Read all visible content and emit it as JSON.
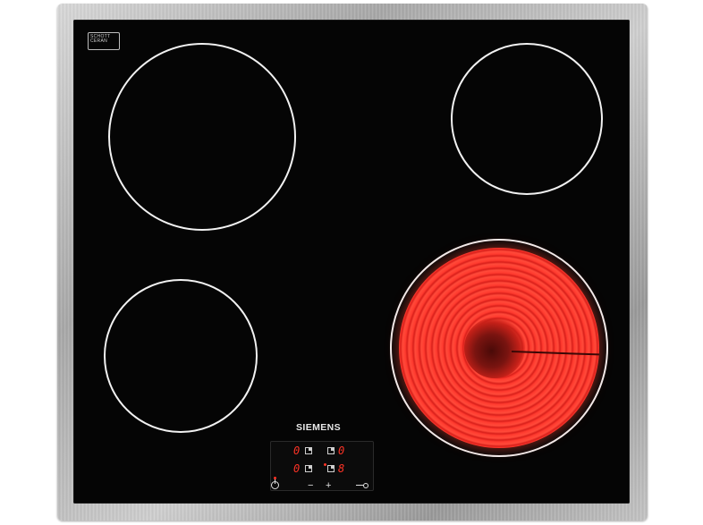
{
  "product": {
    "brand": "SIEMENS",
    "glass_badge_line1": "SCHOTT",
    "glass_badge_line2": "CERAN"
  },
  "cooking_zones": [
    {
      "id": "front-left",
      "state": "off"
    },
    {
      "id": "rear-left",
      "state": "off"
    },
    {
      "id": "rear-right",
      "state": "off"
    },
    {
      "id": "front-right",
      "state": "heating"
    }
  ],
  "control_panel": {
    "displays": [
      {
        "zone": "rear-left",
        "value": "0"
      },
      {
        "zone": "rear-right",
        "value": "0"
      },
      {
        "zone": "front-left",
        "value": "0"
      },
      {
        "zone": "front-right",
        "value": "8"
      }
    ],
    "minus_label": "−",
    "plus_label": "+",
    "icons": [
      "power-icon",
      "zone-select-icon",
      "key-lock-icon"
    ]
  },
  "colors": {
    "glass": "#050505",
    "frame": "#b5b5b5",
    "heat": "#ff3b2f",
    "display": "#ff3326"
  }
}
